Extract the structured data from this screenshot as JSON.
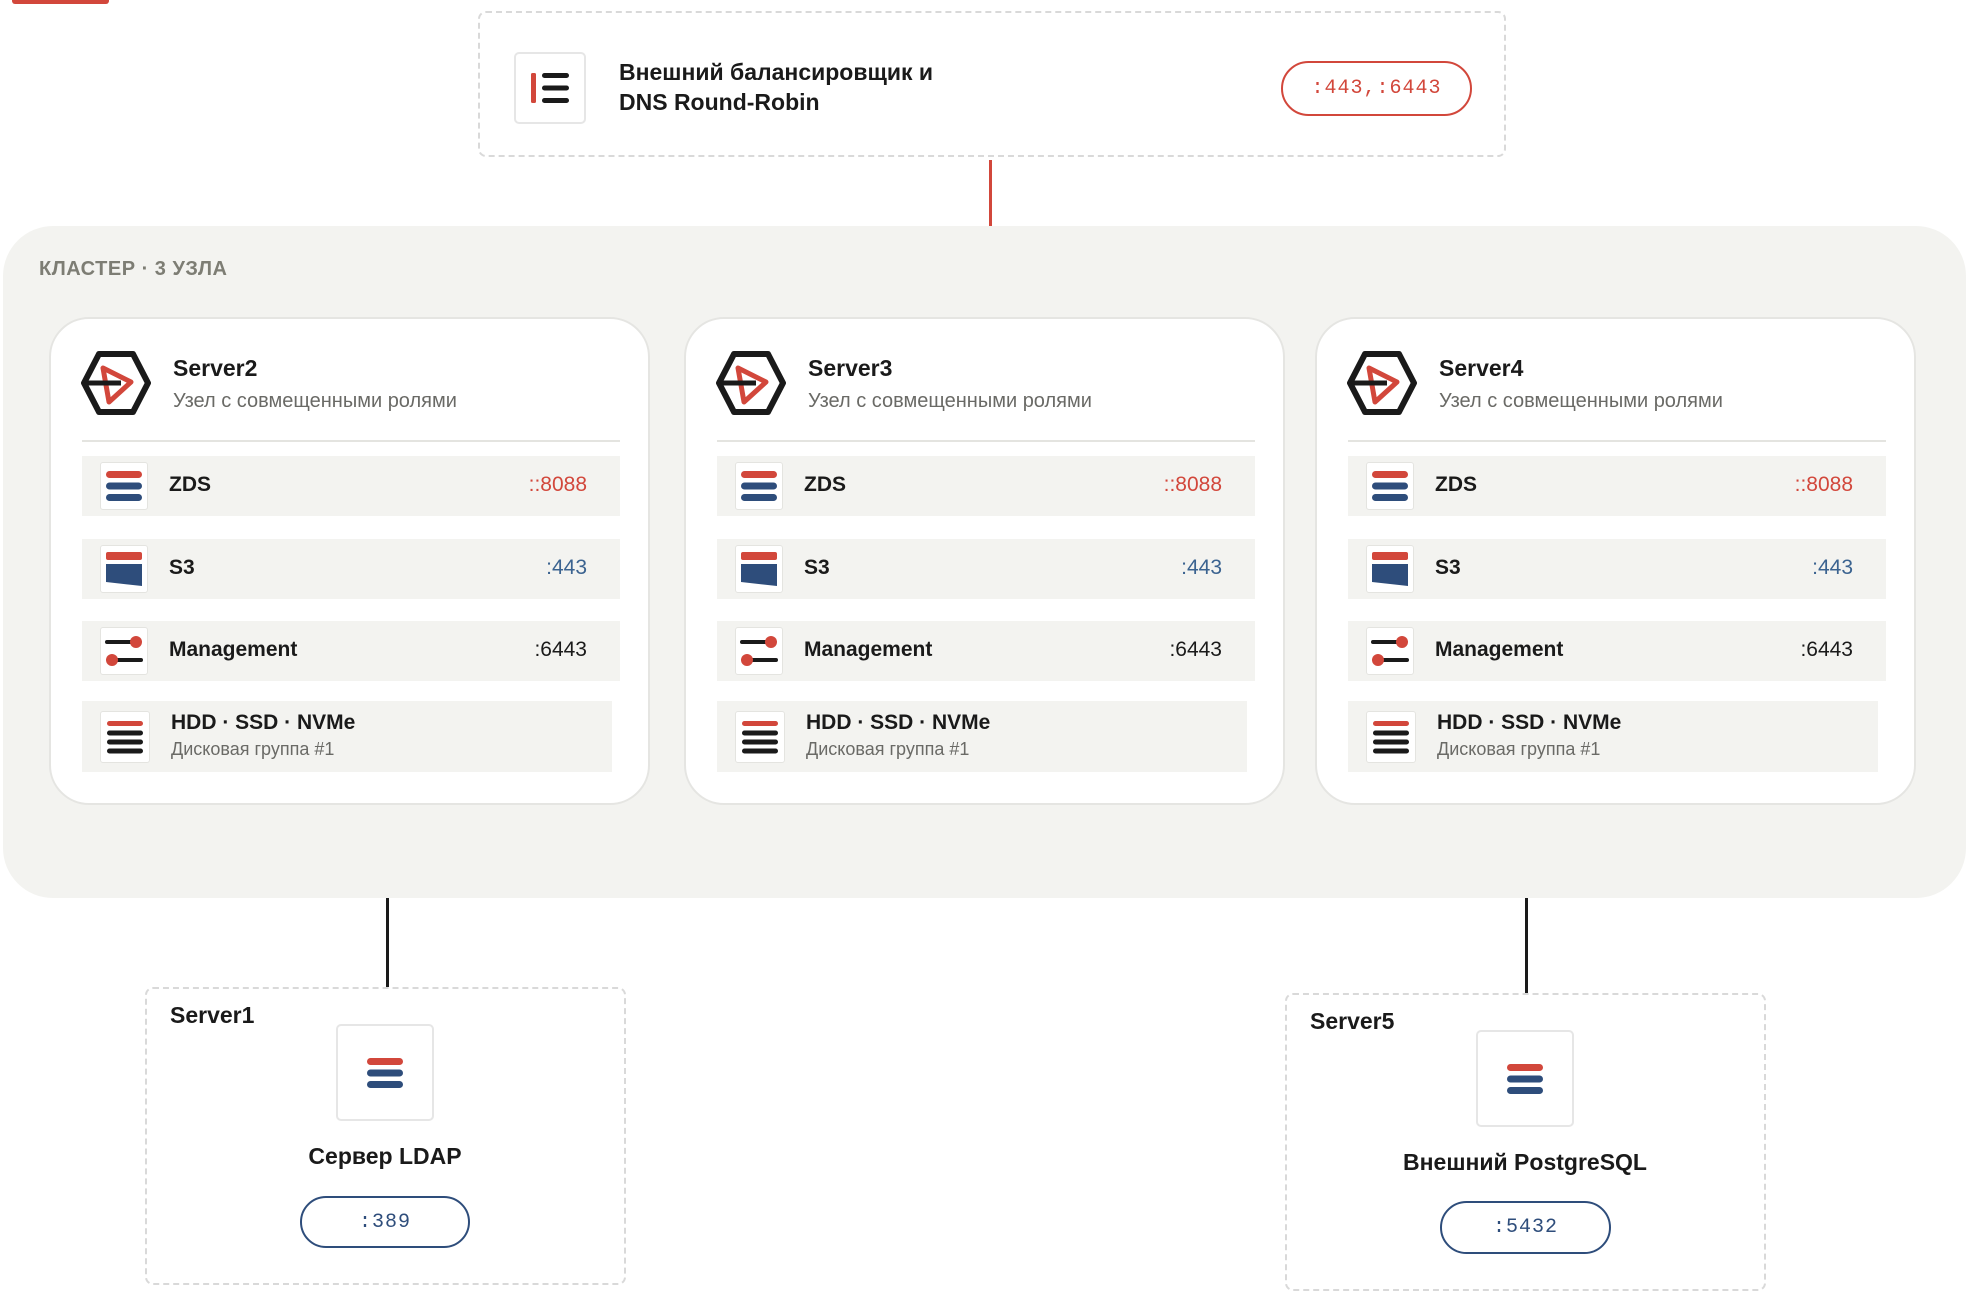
{
  "load_balancer": {
    "title_line1": "Внешний балансировщик и",
    "title_line2": "DNS Round-Robin",
    "ports": ":443,:6443",
    "icon": "load-balancer-icon"
  },
  "cluster": {
    "label": "КЛАСТЕР · 3 УЗЛА",
    "nodes": [
      {
        "name": "Server2",
        "subtitle": "Узел с совмещенными ролями",
        "services": [
          {
            "name": "ZDS",
            "port": "::8088"
          },
          {
            "name": "S3",
            "port": ":443"
          },
          {
            "name": "Management",
            "port": ":6443"
          }
        ],
        "disk": {
          "name": "HDD · SSD · NVMe",
          "group": "Дисковая группа #1"
        }
      },
      {
        "name": "Server3",
        "subtitle": "Узел с совмещенными ролями",
        "services": [
          {
            "name": "ZDS",
            "port": "::8088"
          },
          {
            "name": "S3",
            "port": ":443"
          },
          {
            "name": "Management",
            "port": ":6443"
          }
        ],
        "disk": {
          "name": "HDD · SSD · NVMe",
          "group": "Дисковая группа #1"
        }
      },
      {
        "name": "Server4",
        "subtitle": "Узел с совмещенными ролями",
        "services": [
          {
            "name": "ZDS",
            "port": "::8088"
          },
          {
            "name": "S3",
            "port": ":443"
          },
          {
            "name": "Management",
            "port": ":6443"
          }
        ],
        "disk": {
          "name": "HDD · SSD · NVMe",
          "group": "Дисковая группа #1"
        }
      }
    ]
  },
  "externals": {
    "ldap": {
      "server": "Server1",
      "name": "Сервер LDAP",
      "port": ":389"
    },
    "postgres": {
      "server": "Server5",
      "name": "Внешний PostgreSQL",
      "port": ":5432"
    }
  },
  "colors": {
    "accent_red": "#d2473b",
    "accent_blue": "#2e4d7b",
    "cluster_bg": "#f3f3f0"
  }
}
